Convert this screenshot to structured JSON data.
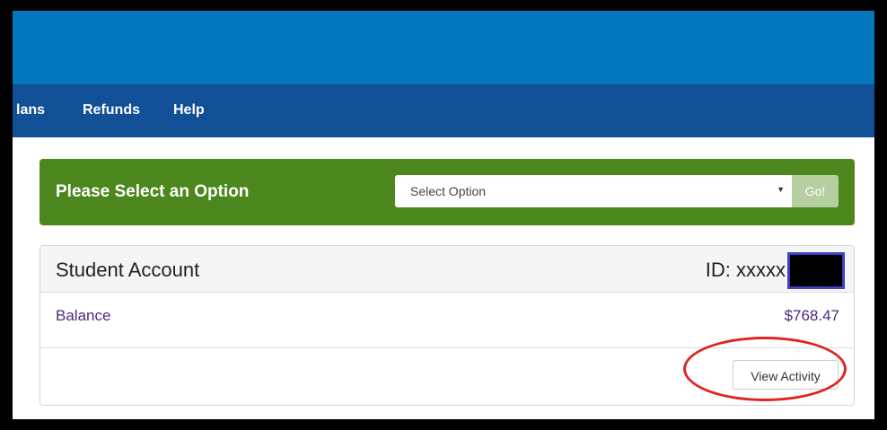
{
  "nav": {
    "items": [
      {
        "label": "lans"
      },
      {
        "label": "Refunds"
      },
      {
        "label": "Help"
      }
    ]
  },
  "option_panel": {
    "title": "Please Select an Option",
    "select_value": "Select Option",
    "go_label": "Go!",
    "panel_color": "#4b871c"
  },
  "account": {
    "title": "Student Account",
    "id_label": "ID: xxxxx",
    "balance_label": "Balance",
    "balance_value": "$768.47",
    "view_button_label": "View Activity"
  },
  "colors": {
    "banner": "#0277bd",
    "nav": "#114f96",
    "annotation": "#e02323"
  }
}
